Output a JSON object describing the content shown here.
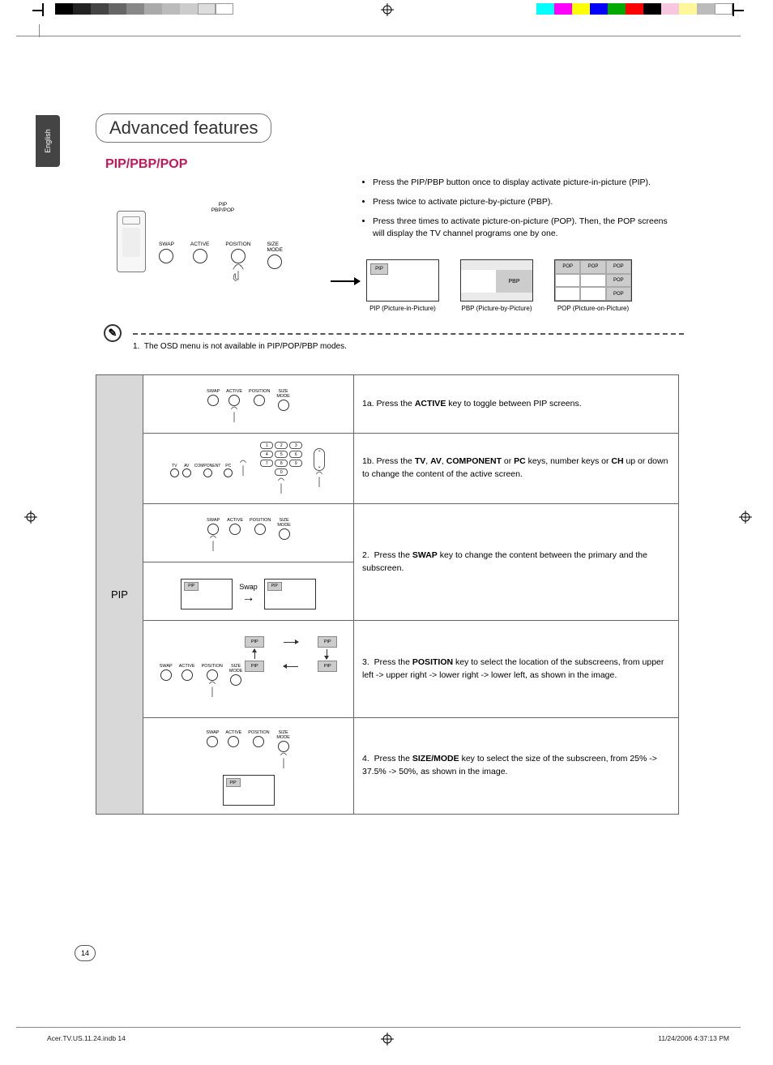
{
  "lang_tab": "English",
  "heading": "Advanced features",
  "subheading": "PIP/PBP/POP",
  "bullets": [
    "Press the PIP/PBP button once to display activate picture-in-picture (PIP).",
    "Press twice to activate picture-by-picture (PBP).",
    "Press  three times to activate picture-on-picture (POP). Then, the POP screens will display the TV channel programs one by one."
  ],
  "remote_buttons": {
    "swap": "SWAP",
    "active": "ACTIVE",
    "position": "POSITION",
    "size": "SIZE\nMODE",
    "pip_top": "PIP\nPBP/POP"
  },
  "mode_labels": {
    "pip": "PIP",
    "pbp": "PBP",
    "pop": "POP"
  },
  "mode_captions": {
    "pip": "PIP (Picture-in-Picture)",
    "pbp": "PBP (Picture-by-Picture)",
    "pop": "POP (Picture-on-Picture)"
  },
  "note_num": "1.",
  "note_text": "The OSD menu is not available in PIP/POP/PBP modes.",
  "note_icon": "✎",
  "table_label": "PIP",
  "steps": {
    "s1a_num": "1a.",
    "s1a_pre": "Press the ",
    "s1a_b": "ACTIVE",
    "s1a_post": " key to toggle between PIP screens.",
    "s1b_num": "1b.",
    "s1b_pre": "Press the ",
    "s1b_b1": "TV",
    "s1b_c1": ", ",
    "s1b_b2": "AV",
    "s1b_c2": ", ",
    "s1b_b3": "COMPONENT",
    "s1b_c3": " or ",
    "s1b_b4": "PC",
    "s1b_post1": " keys, number keys or ",
    "s1b_b5": "CH",
    "s1b_post2": " up or down to change the content of the active screen.",
    "s2_num": "2.",
    "s2_pre": "Press the ",
    "s2_b": "SWAP",
    "s2_post": " key to change the content between the primary and the subscreen.",
    "s3_num": "3.",
    "s3_pre": "Press the ",
    "s3_b": "POSITION",
    "s3_post": " key to select the location of the subscreens, from upper left -> upper right -> lower right -> lower left, as shown in the image.",
    "s4_num": "4.",
    "s4_pre": "Press the ",
    "s4_b": "SIZE/MODE",
    "s4_post": " key to select the size of the subscreen, from 25% -> 37.5% -> 50%, as shown in the image."
  },
  "swap_label": "Swap",
  "src_labels": {
    "tv": "TV",
    "av": "AV",
    "comp": "COMPONENT",
    "pc": "PC"
  },
  "numkeys": [
    "1",
    "2",
    "3",
    "4",
    "5",
    "6",
    "7",
    "8",
    "9",
    "",
    "0",
    ""
  ],
  "ch_up": "⌃",
  "ch_dn": "⌄",
  "page_num": "14",
  "footer_left": "Acer.TV.US.11.24.indb   14",
  "footer_right": "11/24/2006   4:37:13 PM"
}
